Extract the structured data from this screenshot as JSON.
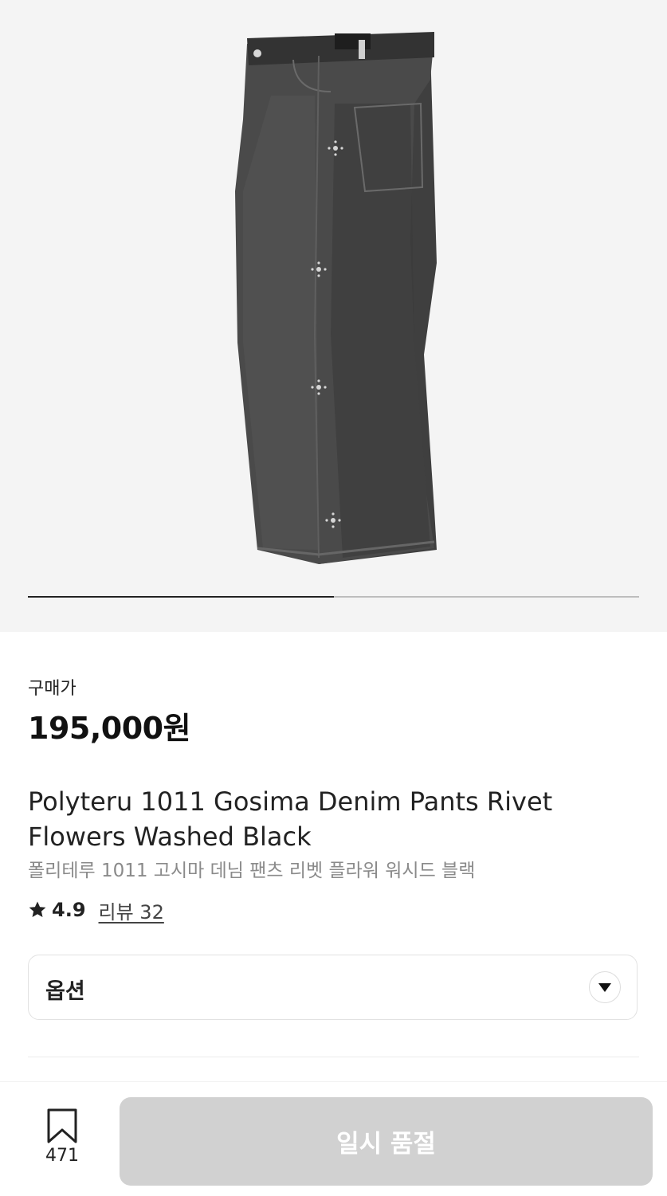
{
  "gallery": {
    "product_image_alt": "product image",
    "progress": 0.5
  },
  "price": {
    "label": "구매가",
    "value": "195,000원"
  },
  "product": {
    "title_line1": "Polyteru 1011 Gosima Denim Pants Rivet",
    "title_line2": "Flowers Washed Black",
    "title_ko": "폴리테루 1011 고시마 데님 팬츠 리벳 플라워 워시드 블랙"
  },
  "rating": {
    "value": "4.9",
    "review_label": "리뷰 32"
  },
  "option": {
    "label": "옵션"
  },
  "bottom_bar": {
    "bookmark_count": "471",
    "action_label": "일시 품절"
  },
  "icons": {
    "star": "star-icon",
    "chevron": "chevron-down-icon",
    "bookmark": "bookmark-icon"
  },
  "colors": {
    "hero_bg": "#f4f4f4",
    "progress_active": "#222222",
    "progress_track": "#bdbdbd",
    "disabled_button": "#d1d1d1"
  }
}
